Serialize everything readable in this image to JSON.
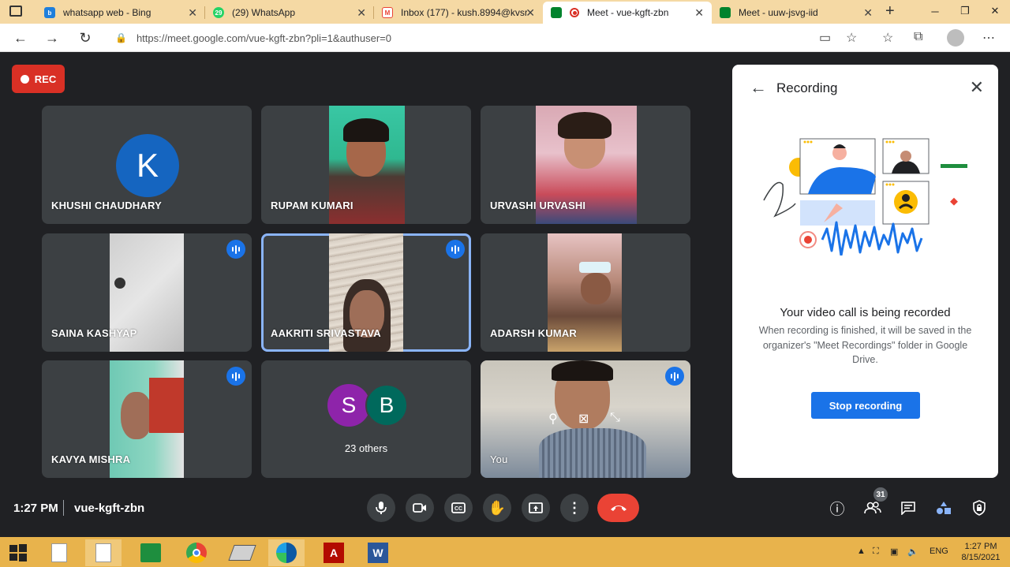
{
  "browser": {
    "tabs": [
      {
        "title": "whatsapp web - Bing",
        "favicon": "bing-icon",
        "color": "#1f7fdc",
        "active": false
      },
      {
        "title": "(29) WhatsApp",
        "favicon": "whatsapp-icon",
        "color": "#25d366",
        "badge": "29",
        "active": false
      },
      {
        "title": "Inbox (177) - kush.8994@kvsr...",
        "favicon": "gmail-icon",
        "color": "#ea4335",
        "active": false
      },
      {
        "title": "Meet - vue-kgft-zbn",
        "favicon": "meet-icon",
        "color": "#00832d",
        "active": true
      },
      {
        "title": "Meet - uuw-jsvg-iid",
        "favicon": "meet-icon",
        "color": "#00832d",
        "active": false
      }
    ],
    "url": "https://meet.google.com/vue-kgft-zbn?pli=1&authuser=0"
  },
  "recording_badge": "REC",
  "participants": [
    {
      "name": "KHUSHI CHAUDHARY",
      "initial": "K"
    },
    {
      "name": "RUPAM KUMARI"
    },
    {
      "name": "URVASHI URVASHI"
    },
    {
      "name": "SAINA KASHYAP",
      "speaking": true
    },
    {
      "name": "AAKRITI SRIVASTAVA",
      "speaking": true,
      "active": true
    },
    {
      "name": "ADARSH KUMAR"
    },
    {
      "name": "KAVYA MISHRA",
      "speaking": true
    },
    {
      "name": "23 others",
      "initials": [
        "S",
        "B"
      ],
      "colors": [
        "#8e24aa",
        "#00695c"
      ]
    },
    {
      "name": "You",
      "speaking": true
    }
  ],
  "panel": {
    "title": "Recording",
    "heading": "Your video call is being recorded",
    "description": "When recording is finished, it will be saved in the organizer's \"Meet Recordings\" folder in Google Drive.",
    "stop_button": "Stop recording"
  },
  "bottom_bar": {
    "time": "1:27 PM",
    "meeting_code": "vue-kgft-zbn",
    "people_count": "31"
  },
  "taskbar": {
    "lang": "ENG",
    "time": "1:27 PM",
    "date": "8/15/2021"
  }
}
